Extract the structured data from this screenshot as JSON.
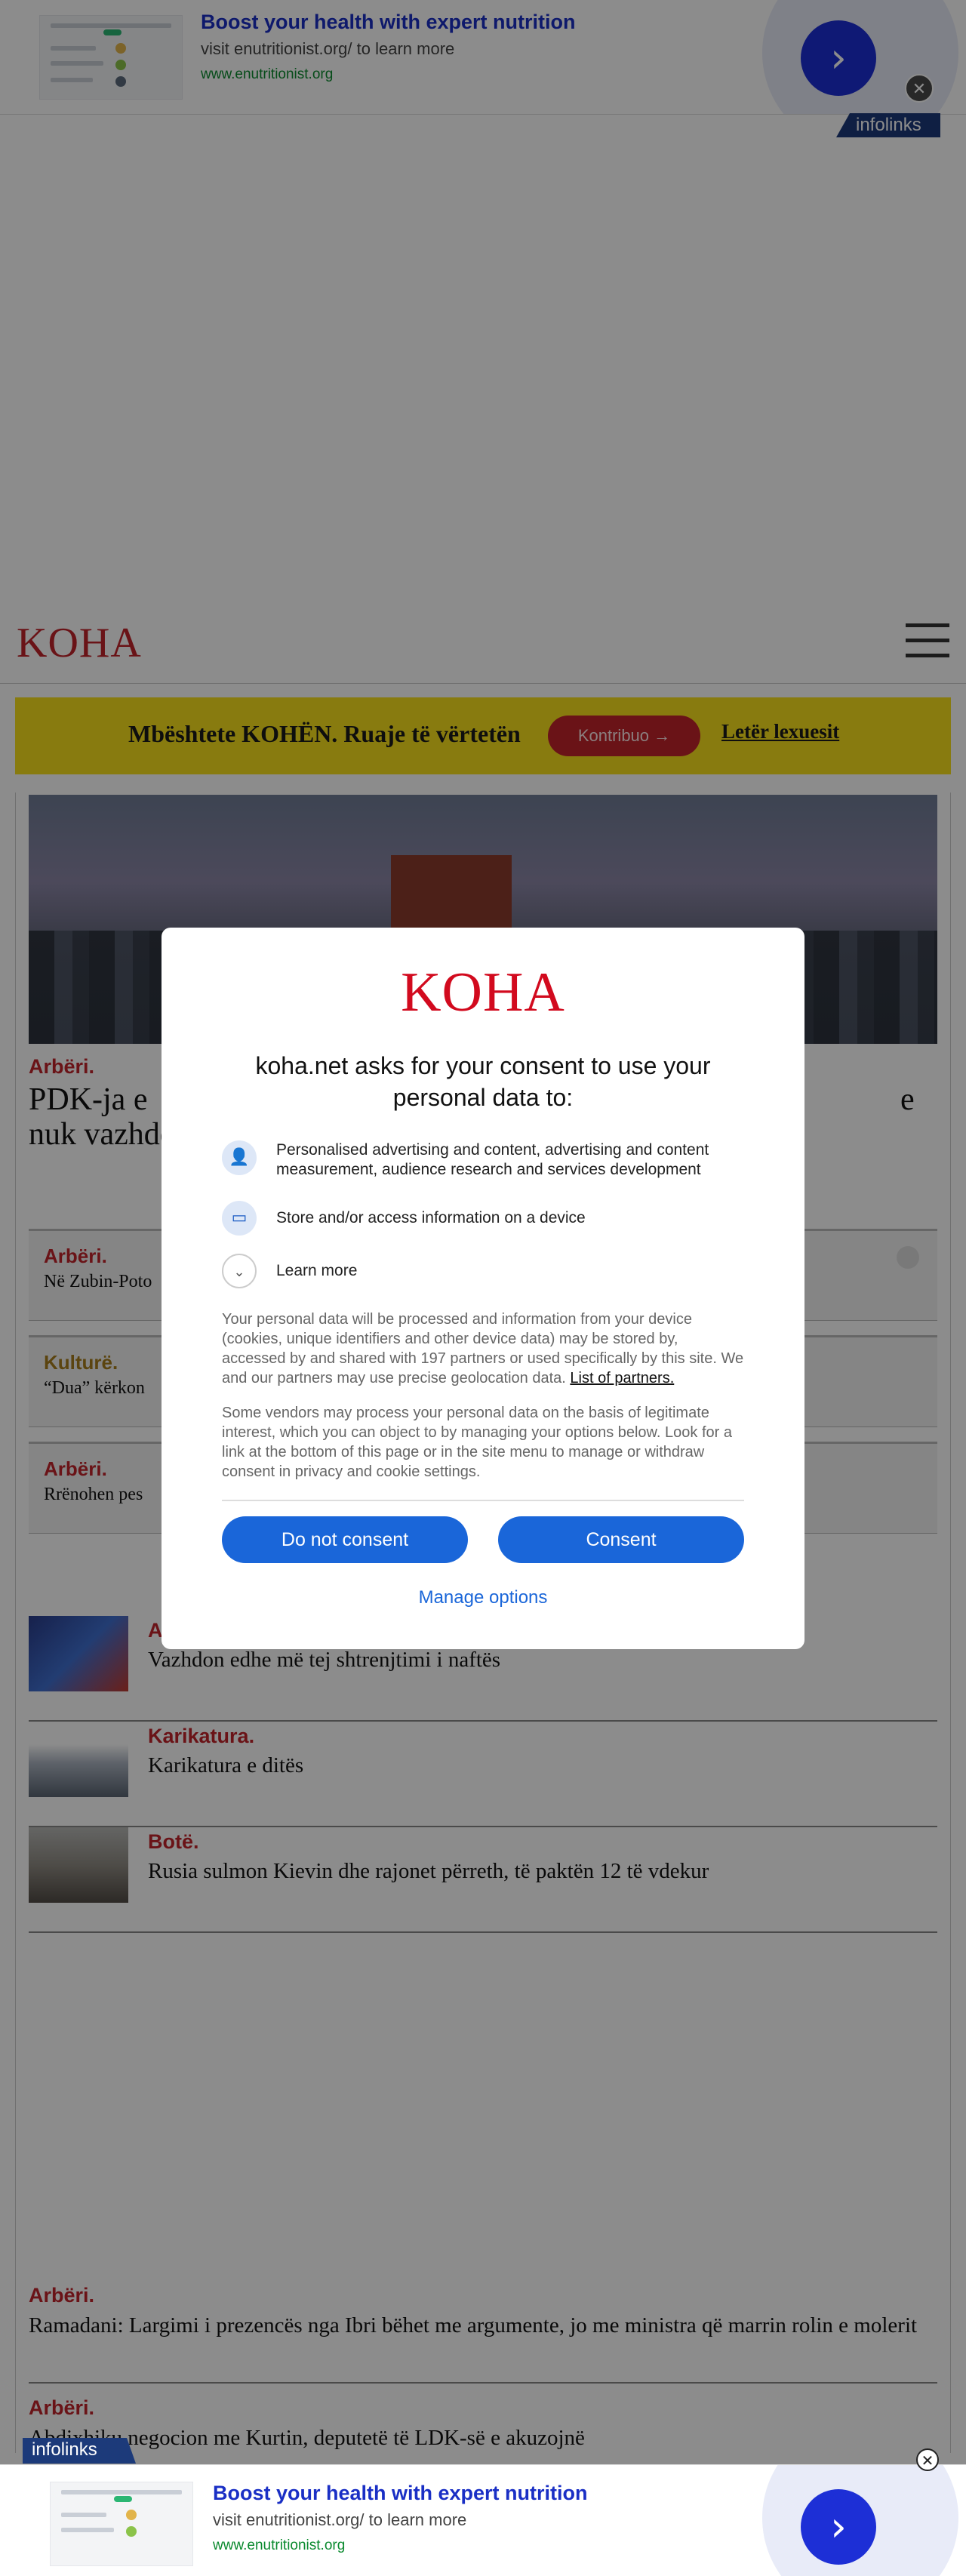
{
  "ads": {
    "headline": "Boost your health with expert nutrition",
    "sub": "visit enutritionist.org/ to learn more",
    "url": "www.enutritionist.org",
    "badge": "infolinks",
    "arrow": "›",
    "close": "✕"
  },
  "header": {
    "logo": "KOHA"
  },
  "support": {
    "text": "Mbështete KOHËN. Ruaje të vërtetën",
    "button": "Kontribuo →",
    "letter": "Letër lexuesit"
  },
  "lead": {
    "category": "Arbëri.",
    "title": "PDK-ja e                                                                                               e nuk vazhdon"
  },
  "boxes": [
    {
      "category": "Arbëri.",
      "title": "Në Zubin-Poto"
    },
    {
      "category": "Kulturë.",
      "title": "“Dua” kërkon"
    },
    {
      "category": "Arbëri.",
      "title": "Rrënohen pes"
    }
  ],
  "rows": [
    {
      "category": "A",
      "title": "Vazhdon edhe më tej shtrenjtimi i naftës"
    },
    {
      "category": "Karikatura.",
      "title": "Karikatura e ditës"
    },
    {
      "category": "Botë.",
      "title": "Rusia sulmon Kievin dhe rajonet përreth, të paktën 12 të vdekur"
    }
  ],
  "stories": [
    {
      "category": "Arbëri.",
      "title": "Ramadani: Largimi i prezencës nga Ibri bëhet me argumente, jo me ministra që marrin rolin e molerit"
    },
    {
      "category": "Arbëri.",
      "title": "Abdixhiku negocion me Kurtin, deputetë të LDK-së e akuzojnë"
    }
  ],
  "consent": {
    "logo": "KOHA",
    "title": "koha.net asks for your consent to use your personal data to:",
    "purposes": [
      {
        "icon": "person-icon",
        "text": "Personalised advertising and content, advertising and content measurement, audience research and services development"
      },
      {
        "icon": "device-icon",
        "text": "Store and/or access information on a device"
      }
    ],
    "learn_more": "Learn more",
    "para1": "Your personal data will be processed and information from your device (cookies, unique identifiers and other device data) may be stored by, accessed by and shared with 197 partners or used specifically by this site. We and our partners may use precise geolocation data.",
    "partners_link": "List of partners.",
    "para2": "Some vendors may process your personal data on the basis of legitimate interest, which you can object to by managing your options below. Look for a link at the bottom of this page or in the site menu to manage or withdraw consent in privacy and cookie settings.",
    "do_not_consent": "Do not consent",
    "consent": "Consent",
    "manage": "Manage options"
  },
  "colors": {
    "brand": "#c1232b",
    "consent_blue": "#1a66d9",
    "support_yellow": "#f8e11c"
  }
}
